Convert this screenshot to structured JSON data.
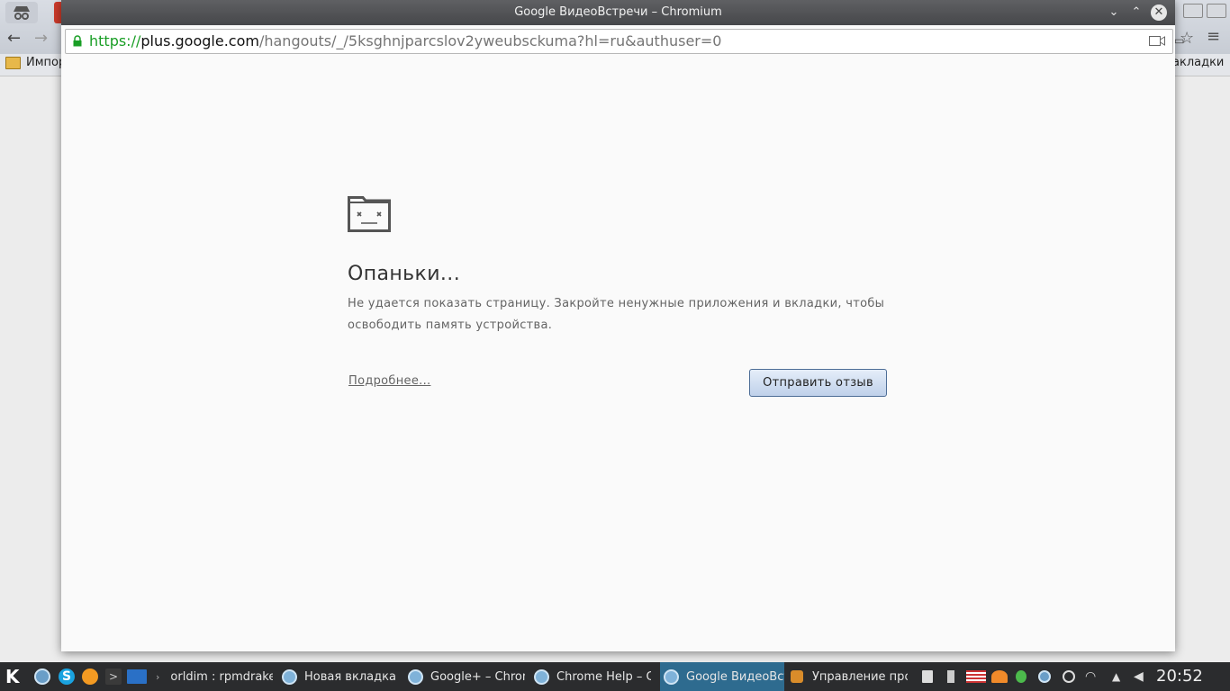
{
  "background_browser": {
    "bookmark_left": "Импор",
    "bookmark_right": "акладки"
  },
  "window": {
    "title": "Google ВидеоВстречи – Chromium"
  },
  "address": {
    "scheme": "https://",
    "host": "plus.google.com",
    "path": "/hangouts/_/5ksghnjparcslov2yweubsckuma?hl=ru&authuser=0"
  },
  "error_page": {
    "title": "Опаньки...",
    "description": "Не удается показать страницу. Закройте ненужные приложения и вкладки, чтобы освободить память устройства.",
    "learn_more": "Подробнее...",
    "feedback_button": "Отправить отзыв"
  },
  "taskbar": {
    "tasks": [
      {
        "label": "orldim : rpmdrake"
      },
      {
        "label": "Новая вкладка – Chromium"
      },
      {
        "label": "Google+ – Chromium"
      },
      {
        "label": "Chrome Help – Chromium"
      },
      {
        "label": "Google ВидеоВстречи"
      },
      {
        "label": "Управление программами"
      }
    ],
    "active_task_index": 4,
    "clock": "20:52"
  }
}
